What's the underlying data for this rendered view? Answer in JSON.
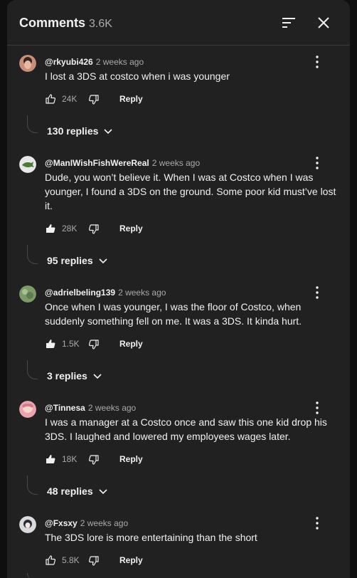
{
  "header": {
    "title": "Comments",
    "count": "3.6K"
  },
  "comments": [
    {
      "handle": "@rkyubi426",
      "time": "2 weeks ago",
      "text": "I lost a 3DS at costco when i was younger",
      "likes": "24K",
      "reply_label": "Reply",
      "replies": "130 replies"
    },
    {
      "handle": "@ManIWishFishWereReal",
      "time": "2 weeks ago",
      "text": "Dude, you won’t believe it. When I was at Costco when I was younger, I found a 3DS on the ground. Some poor kid must’ve lost it.",
      "likes": "28K",
      "reply_label": "Reply",
      "replies": "95 replies"
    },
    {
      "handle": "@adrielbeling139",
      "time": "2 weeks ago",
      "text": "Once when I was younger, I was the floor of Costco, when suddenly something fell on me. It was a 3DS. It kinda hurt.",
      "likes": "1.5K",
      "reply_label": "Reply",
      "replies": "3 replies"
    },
    {
      "handle": "@Tinnesa",
      "time": "2 weeks ago",
      "text": "I was a manager at a Costco once and saw this one kid drop his 3DS. I laughed and lowered my employees wages later.",
      "likes": "18K",
      "reply_label": "Reply",
      "replies": "48 replies"
    },
    {
      "handle": "@Fxsxy",
      "time": "2 weeks ago",
      "text": "The 3DS lore is more entertaining than the short",
      "likes": "5.8K",
      "reply_label": "Reply"
    }
  ]
}
